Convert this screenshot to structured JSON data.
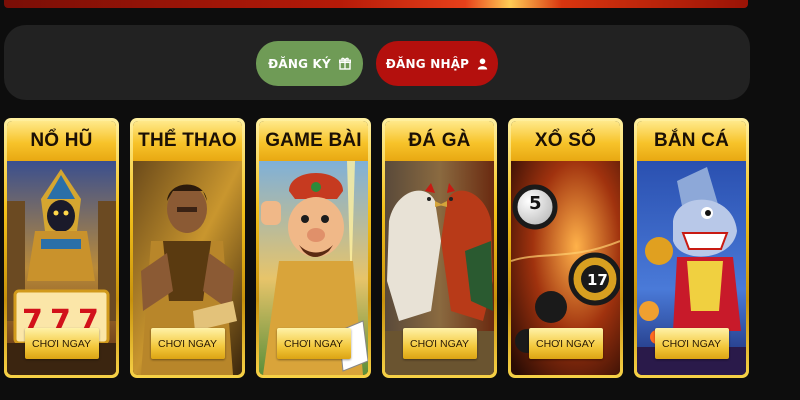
{
  "auth": {
    "register_label": "ĐĂNG KÝ",
    "login_label": "ĐĂNG NHẬP",
    "register_icon": "gift-icon",
    "login_icon": "user-icon",
    "register_color": "#6f9b56",
    "login_color": "#b4100d"
  },
  "categories": [
    {
      "title": "NỔ HŨ",
      "cta": "CHƠI NGAY",
      "art": "pharaoh-slot-art"
    },
    {
      "title": "THỂ THAO",
      "cta": "CHƠI NGAY",
      "art": "football-player-art"
    },
    {
      "title": "GAME BÀI",
      "cta": "CHƠI NGAY",
      "art": "card-game-character-art"
    },
    {
      "title": "ĐÁ GÀ",
      "cta": "CHƠI NGAY",
      "art": "rooster-fight-art"
    },
    {
      "title": "XỔ SỐ",
      "cta": "CHƠI NGAY",
      "art": "lottery-balls-art"
    },
    {
      "title": "BẮN CÁ",
      "cta": "CHƠI NGAY",
      "art": "shark-fishing-art"
    }
  ],
  "colors": {
    "gold": "#f4c21b",
    "background": "#0d0d0d",
    "panel": "#222222"
  }
}
